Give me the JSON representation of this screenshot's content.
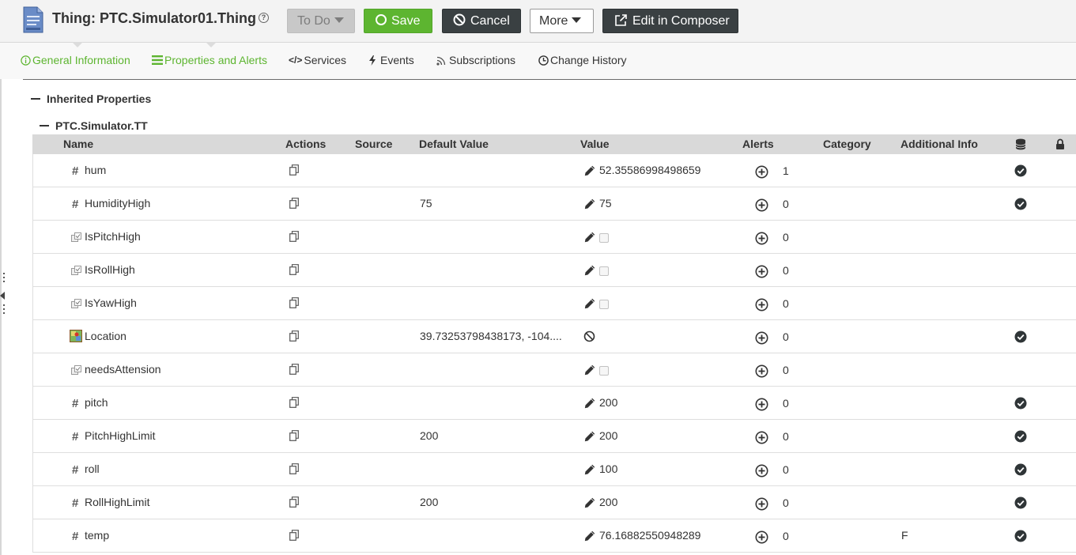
{
  "header": {
    "title": "Thing: PTC.Simulator01.Thing",
    "todo_label": "To Do",
    "save_label": "Save",
    "cancel_label": "Cancel",
    "more_label": "More",
    "composer_label": "Edit in Composer"
  },
  "tabs": [
    {
      "label": "General Information",
      "icon": "info-icon",
      "active": true
    },
    {
      "label": "Properties and Alerts",
      "icon": "list-icon",
      "active": true
    },
    {
      "label": "Services",
      "icon": "code-icon",
      "active": false
    },
    {
      "label": "Events",
      "icon": "bolt-icon",
      "active": false
    },
    {
      "label": "Subscriptions",
      "icon": "rss-icon",
      "active": false
    },
    {
      "label": "Change History",
      "icon": "history-icon",
      "active": false
    }
  ],
  "section": {
    "inherited_title": "Inherited Properties",
    "group_title": "PTC.Simulator.TT"
  },
  "table": {
    "columns": {
      "name": "Name",
      "actions": "Actions",
      "source": "Source",
      "default_value": "Default Value",
      "value": "Value",
      "alerts": "Alerts",
      "category": "Category",
      "additional_info": "Additional Info"
    },
    "rows": [
      {
        "name": "hum",
        "type": "number",
        "default": "",
        "value": "52.35586998498659",
        "alerts": "1",
        "info": "",
        "persistent": true
      },
      {
        "name": "HumidityHigh",
        "type": "number",
        "default": "75",
        "value": "75",
        "alerts": "0",
        "info": "",
        "persistent": true
      },
      {
        "name": "IsPitchHigh",
        "type": "boolean",
        "default": "",
        "value": "",
        "alerts": "0",
        "info": "",
        "persistent": false
      },
      {
        "name": "IsRollHigh",
        "type": "boolean",
        "default": "",
        "value": "",
        "alerts": "0",
        "info": "",
        "persistent": false
      },
      {
        "name": "IsYawHigh",
        "type": "boolean",
        "default": "",
        "value": "",
        "alerts": "0",
        "info": "",
        "persistent": false
      },
      {
        "name": "Location",
        "type": "location",
        "default": "39.73253798438173, -104....",
        "value": "",
        "alerts": "0",
        "info": "",
        "persistent": true
      },
      {
        "name": "needsAttension",
        "type": "boolean",
        "default": "",
        "value": "",
        "alerts": "0",
        "info": "",
        "persistent": false
      },
      {
        "name": "pitch",
        "type": "number",
        "default": "",
        "value": "200",
        "alerts": "0",
        "info": "",
        "persistent": true
      },
      {
        "name": "PitchHighLimit",
        "type": "number",
        "default": "200",
        "value": "200",
        "alerts": "0",
        "info": "",
        "persistent": true
      },
      {
        "name": "roll",
        "type": "number",
        "default": "",
        "value": "100",
        "alerts": "0",
        "info": "",
        "persistent": true
      },
      {
        "name": "RollHighLimit",
        "type": "number",
        "default": "200",
        "value": "200",
        "alerts": "0",
        "info": "",
        "persistent": true
      },
      {
        "name": "temp",
        "type": "number",
        "default": "",
        "value": "76.16882550948289",
        "alerts": "0",
        "info": "F",
        "persistent": true
      }
    ]
  },
  "colors": {
    "accent": "#5db530",
    "dark_button": "#3a4042"
  }
}
